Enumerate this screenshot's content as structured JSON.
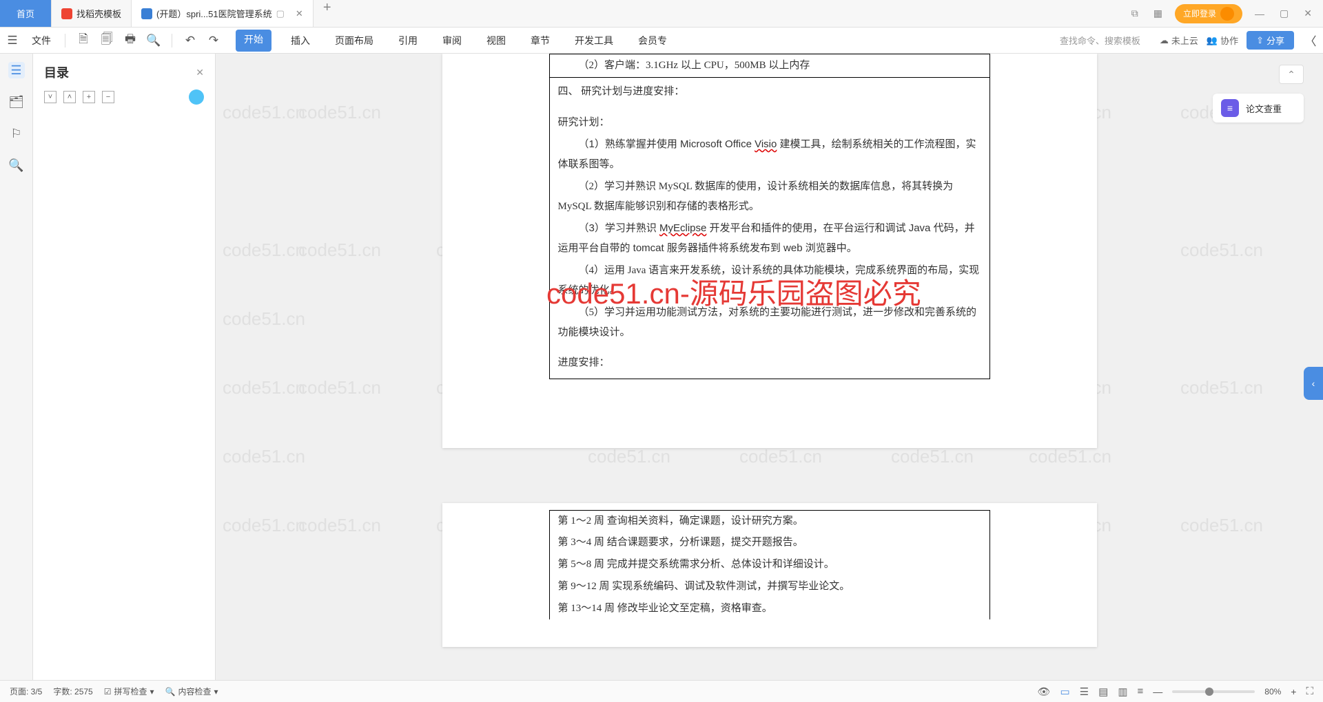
{
  "tabs": {
    "home": "首页",
    "t1": "找稻壳模板",
    "t2": "(开题）spri...51医院管理系统"
  },
  "title_right": {
    "login": "立即登录"
  },
  "toolbar": {
    "file": "文件"
  },
  "menus": [
    "开始",
    "插入",
    "页面布局",
    "引用",
    "审阅",
    "视图",
    "章节",
    "开发工具",
    "会员专"
  ],
  "search_hint": "查找命令、搜索模板",
  "tb_right": {
    "cloud": "未上云",
    "collab": "协作",
    "share": "分享"
  },
  "outline": {
    "title": "目录"
  },
  "right_panel": {
    "item1": "论文查重"
  },
  "doc": {
    "client_line": "（2）客户端：3.1GHz 以上 CPU，500MB 以上内存",
    "sec4": "四、 研究计划与进度安排：",
    "plan_title": "研究计划：",
    "p1a": "（1）熟练掌握并使用 Microsoft Office ",
    "p1u": "Visio",
    "p1b": " 建模工具，绘制系统相关的工作流程图，实体联系图等。",
    "p2": "（2）学习并熟识 MySQL 数据库的使用，设计系统相关的数据库信息，将其转换为 MySQL 数据库能够识别和存储的表格形式。",
    "p3a": "（3）学习并熟识 ",
    "p3u": "MyEclipse",
    "p3b": " 开发平台和插件的使用，在平台运行和调试 Java 代码，并运用平台自带的 tomcat 服务器插件将系统发布到 web 浏览器中。",
    "p4": "（4）运用 Java 语言来开发系统，设计系统的具体功能模块，完成系统界面的布局，实现系统的优化。",
    "p5": "（5）学习并运用功能测试方法，对系统的主要功能进行测试，进一步修改和完善系统的功能模块设计。",
    "schedule_title": "进度安排：",
    "s1": "第 1～2 周  查询相关资料，确定课题，设计研究方案。",
    "s2": "第 3～4 周  结合课题要求，分析课题，提交开题报告。",
    "s3": "第 5～8 周  完成并提交系统需求分析、总体设计和详细设计。",
    "s4": "第 9～12 周  实现系统编码、调试及软件测试，并撰写毕业论文。",
    "s5": "第 13～14 周  修改毕业论文至定稿，资格审查。"
  },
  "big_watermark": "code51.cn-源码乐园盗图必究",
  "wm": "code51.cn",
  "status": {
    "page": "页面: 3/5",
    "words": "字数: 2575",
    "spell": "拼写检查",
    "content": "内容检查",
    "zoom": "80%"
  }
}
